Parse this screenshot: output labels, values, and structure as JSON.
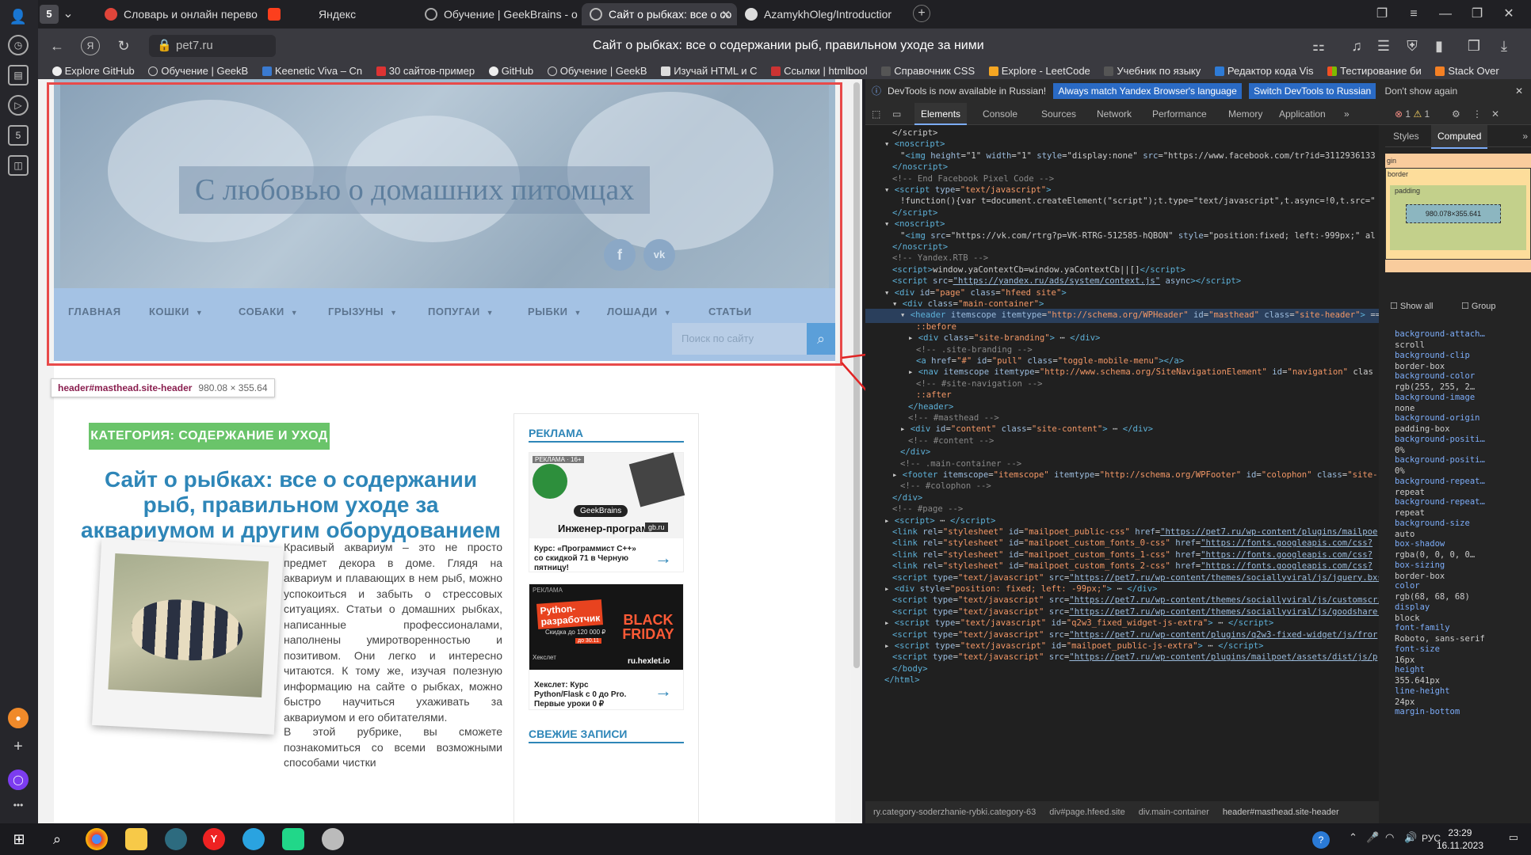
{
  "browser": {
    "tab_count": "5",
    "tabs": [
      {
        "label": "Словарь и онлайн перево"
      },
      {
        "label": "Яндекс"
      },
      {
        "label": "Обучение | GeekBrains - о"
      },
      {
        "label": "Сайт о рыбках: все о со"
      },
      {
        "label": "AzamykhOleg/Introductior"
      }
    ],
    "url": "pet7.ru",
    "page_title": "Сайт о рыбках: все о содержании рыб, правильном уходе за ними",
    "bookmarks": [
      "Explore GitHub",
      "Обучение | GeekB",
      "Keenetic Viva – Cn",
      "30 сайтов-пример",
      "GitHub",
      "Обучение | GeekB",
      "Изучай HTML и C",
      "Ссылки | htmlbool",
      "Справочник CSS",
      "Explore - LeetCode",
      "Учебник по языку",
      "Редактор кода Vis",
      "Тестирование би",
      "Stack Over"
    ]
  },
  "site": {
    "hero_title": "С любовью о домашних питомцах",
    "social": [
      "f",
      "vk"
    ],
    "menu": [
      "ГЛАВНАЯ",
      "КОШКИ",
      "СОБАКИ",
      "ГРЫЗУНЫ",
      "ПОПУГАИ",
      "РЫБКИ",
      "ЛОШАДИ",
      "СТАТЬИ"
    ],
    "search_placeholder": "Поиск по сайту",
    "category_label": "КАТЕГОРИЯ: СОДЕРЖАНИЕ И УХОД",
    "article_title": "Сайт о рыбках: все о содержании рыб, правильном уходе за аквариумом и другим оборудованием",
    "article_p1": "Красивый аквариум – это не просто предмет декора в доме. Глядя на аквариум и плавающих в нем рыб, можно успокоиться и забыть о стрессовых ситуациях. Статьи о домашних рыбках, написанные профессионалами, наполнены умиротворенностью и позитивом. Они легко и интересно читаются. К тому же, изучая полезную информацию на сайте о рыбках, можно быстро научиться ухаживать за аквариумом и его обитателями.",
    "article_p2": "В этой рубрике, вы сможете познакомиться со всеми возможными способами чистки",
    "sidebar": {
      "ads_heading": "РЕКЛАМА",
      "ad1_badge": "РЕКЛАМА · 16+",
      "ad1_brand": "GeekBrains",
      "ad1_headline": "Инженер-программист C++",
      "ad1_site": "gb.ru",
      "ad1_text": "Курс: «Программист C++» со скидкой 71 в Черную пятницу!",
      "ad2_badge": "РЕКЛАМА",
      "ad2_headline": "Python-разработчик",
      "ad2_discount": "Скидка до 120 000 ₽",
      "ad2_date": "до 30.11",
      "ad2_promo": "BLACK FRIDAY",
      "ad2_brand": "Хекслет",
      "ad2_site": "ru.hexlet.io",
      "ad2_text": "Хекслет: Курс Python/Flask с 0 до Pro. Первые уроки 0 ₽",
      "recent_heading": "СВЕЖИЕ ЗАПИСИ"
    },
    "inspect_tooltip": {
      "selector": "header#masthead.site-header",
      "size": "980.08 × 355.64"
    }
  },
  "devtools": {
    "banner_text": "DevTools is now available in Russian!",
    "banner_btn1": "Always match Yandex Browser's language",
    "banner_btn2": "Switch DevTools to Russian",
    "banner_btn3": "Don't show again",
    "tabs": [
      "Elements",
      "Console",
      "Sources",
      "Network",
      "Performance",
      "Memory",
      "Application"
    ],
    "errors": "1",
    "warnings": "1",
    "right_tabs": [
      "Styles",
      "Computed"
    ],
    "box_size": "980.078×355.641",
    "box_labels": {
      "margin": "gin",
      "border": "border",
      "padding": "padding",
      "dash": "–"
    },
    "show_all": "Show all",
    "group": "Group",
    "computed": [
      {
        "name": "background-attach…",
        "value": "scroll"
      },
      {
        "name": "background-clip",
        "value": "border-box"
      },
      {
        "name": "background-color",
        "value": "rgb(255, 255, 2…"
      },
      {
        "name": "background-image",
        "value": "none"
      },
      {
        "name": "background-origin",
        "value": "padding-box"
      },
      {
        "name": "background-positi…",
        "value": "0%"
      },
      {
        "name": "background-positi…",
        "value": "0%"
      },
      {
        "name": "background-repeat…",
        "value": "repeat"
      },
      {
        "name": "background-repeat…",
        "value": "repeat"
      },
      {
        "name": "background-size",
        "value": "auto"
      },
      {
        "name": "box-shadow",
        "value": "rgba(0, 0, 0, 0…"
      },
      {
        "name": "box-sizing",
        "value": "border-box"
      },
      {
        "name": "color",
        "value": "rgb(68, 68, 68)"
      },
      {
        "name": "display",
        "value": "block"
      },
      {
        "name": "font-family",
        "value": "Roboto, sans-serif"
      },
      {
        "name": "font-size",
        "value": "16px"
      },
      {
        "name": "height",
        "value": "355.641px"
      },
      {
        "name": "line-height",
        "value": "24px"
      },
      {
        "name": "margin-bottom",
        "value": ""
      }
    ],
    "breadcrumbs": [
      "ry.category-soderzhanie-rybki.category-63",
      "div#page.hfeed.site",
      "div.main-container",
      "header#masthead.site-header"
    ],
    "code_lines": [
      {
        "i": 2,
        "html": "&lt;/script&gt;"
      },
      {
        "i": 1,
        "html": "▾ <span class='tg'>&lt;noscript&gt;</span>"
      },
      {
        "i": 3,
        "html": "\"<span class='tg'>&lt;img</span> <span class='at'>height</span>=\"1\" <span class='at'>width</span>=\"1\" <span class='at'>style</span>=\"display:none\" <span class='at'>src</span>=\"https://www.facebook.com/tr?id=3112936133"
      },
      {
        "i": 2,
        "html": "<span class='tg'>&lt;/noscript&gt;</span>"
      },
      {
        "i": 2,
        "html": "<span class='cm'>&lt;!-- End Facebook Pixel Code --&gt;</span>"
      },
      {
        "i": 1,
        "html": "▾ <span class='tg'>&lt;script</span> <span class='at'>type</span>=<span class='av'>\"text/javascript\"</span><span class='tg'>&gt;</span>"
      },
      {
        "i": 3,
        "html": "!function(){var t=document.createElement(\"script\");t.type=\"text/javascript\",t.async=!0,t.src=\""
      },
      {
        "i": 2,
        "html": "<span class='tg'>&lt;/script&gt;</span>"
      },
      {
        "i": 1,
        "html": "▾ <span class='tg'>&lt;noscript&gt;</span>"
      },
      {
        "i": 3,
        "html": "\"<span class='tg'>&lt;img</span> <span class='at'>src</span>=\"https://vk.com/rtrg?p=VK-RTRG-512585-hQBON\" <span class='at'>style</span>=\"position:fixed; left:-999px;\" al"
      },
      {
        "i": 2,
        "html": "<span class='tg'>&lt;/noscript&gt;</span>"
      },
      {
        "i": 2,
        "html": "<span class='cm'>&lt;!-- Yandex.RTB --&gt;</span>"
      },
      {
        "i": 2,
        "html": "<span class='tg'>&lt;script&gt;</span>window.yaContextCb=window.yaContextCb||[]<span class='tg'>&lt;/script&gt;</span>"
      },
      {
        "i": 2,
        "html": "<span class='tg'>&lt;script</span> <span class='at'>src</span>=<span class='lk'>\"https://yandex.ru/ads/system/context.js\"</span> <span class='at'>async</span><span class='tg'>&gt;&lt;/script&gt;</span>"
      },
      {
        "i": 1,
        "html": "▾ <span class='tg'>&lt;div</span> <span class='at'>id</span>=<span class='av'>\"page\"</span> <span class='at'>class</span>=<span class='av'>\"hfeed site\"</span><span class='tg'>&gt;</span>"
      },
      {
        "i": 2,
        "html": "▾ <span class='tg'>&lt;div</span> <span class='at'>class</span>=<span class='av'>\"main-container\"</span><span class='tg'>&gt;</span>"
      },
      {
        "i": 3,
        "html": "▾ <span class='tg'>&lt;header</span> <span class='at'>itemscope</span> <span class='at'>itemtype</span>=<span class='av'>\"http://schema.org/WPHeader\"</span> <span class='at'>id</span>=<span class='av'>\"masthead\"</span> <span class='at'>class</span>=<span class='av'>\"site-header\"</span><span class='tg'>&gt;</span> == $0",
        "sel": true
      },
      {
        "i": 5,
        "html": "<span class='av'>::before</span>"
      },
      {
        "i": 4,
        "html": "▸ <span class='tg'>&lt;div</span> <span class='at'>class</span>=<span class='av'>\"site-branding\"</span><span class='tg'>&gt;</span> ⋯ <span class='tg'>&lt;/div&gt;</span>"
      },
      {
        "i": 5,
        "html": "<span class='cm'>&lt;!-- .site-branding --&gt;</span>"
      },
      {
        "i": 5,
        "html": "<span class='tg'>&lt;a</span> <span class='at'>href</span>=<span class='av'>\"#\"</span> <span class='at'>id</span>=<span class='av'>\"pull\"</span> <span class='at'>class</span>=<span class='av'>\"toggle-mobile-menu\"</span><span class='tg'>&gt;&lt;/a&gt;</span>"
      },
      {
        "i": 4,
        "html": "▸ <span class='tg'>&lt;nav</span> <span class='at'>itemscope</span> <span class='at'>itemtype</span>=<span class='av'>\"http://www.schema.org/SiteNavigationElement\"</span> <span class='at'>id</span>=<span class='av'>\"navigation\"</span> clas"
      },
      {
        "i": 5,
        "html": "<span class='cm'>&lt;!-- #site-navigation --&gt;</span>"
      },
      {
        "i": 5,
        "html": "<span class='av'>::after</span>"
      },
      {
        "i": 4,
        "html": "<span class='tg'>&lt;/header&gt;</span>"
      },
      {
        "i": 4,
        "html": "<span class='cm'>&lt;!-- #masthead --&gt;</span>"
      },
      {
        "i": 3,
        "html": "▸ <span class='tg'>&lt;div</span> <span class='at'>id</span>=<span class='av'>\"content\"</span> <span class='at'>class</span>=<span class='av'>\"site-content\"</span><span class='tg'>&gt;</span> ⋯ <span class='tg'>&lt;/div&gt;</span>"
      },
      {
        "i": 4,
        "html": "<span class='cm'>&lt;!-- #content --&gt;</span>"
      },
      {
        "i": 3,
        "html": "<span class='tg'>&lt;/div&gt;</span>"
      },
      {
        "i": 3,
        "html": "<span class='cm'>&lt;!-- .main-container --&gt;</span>"
      },
      {
        "i": 2,
        "html": "▸ <span class='tg'>&lt;footer</span> <span class='at'>itemscope</span>=<span class='av'>\"itemscope\"</span> <span class='at'>itemtype</span>=<span class='av'>\"http://schema.org/WPFooter\"</span> <span class='at'>id</span>=<span class='av'>\"colophon\"</span> <span class='at'>class</span>=<span class='av'>\"site-</span>"
      },
      {
        "i": 3,
        "html": "<span class='cm'>&lt;!-- #colophon --&gt;</span>"
      },
      {
        "i": 2,
        "html": "<span class='tg'>&lt;/div&gt;</span>"
      },
      {
        "i": 2,
        "html": "<span class='cm'>&lt;!-- #page --&gt;</span>"
      },
      {
        "i": 1,
        "html": "▸ <span class='tg'>&lt;script&gt;</span> ⋯ <span class='tg'>&lt;/script&gt;</span>"
      },
      {
        "i": 2,
        "html": "<span class='tg'>&lt;link</span> <span class='at'>rel</span>=<span class='av'>\"stylesheet\"</span> <span class='at'>id</span>=<span class='av'>\"mailpoet_public-css\"</span> <span class='at'>href</span>=<span class='lk'>\"https://pet7.ru/wp-content/plugins/mailpoe</span>"
      },
      {
        "i": 2,
        "html": "<span class='tg'>&lt;link</span> <span class='at'>rel</span>=<span class='av'>\"stylesheet\"</span> <span class='at'>id</span>=<span class='av'>\"mailpoet_custom_fonts_0-css\"</span> <span class='at'>href</span>=<span class='lk'>\"https://fonts.googleapis.com/css?</span>"
      },
      {
        "i": 2,
        "html": "<span class='tg'>&lt;link</span> <span class='at'>rel</span>=<span class='av'>\"stylesheet\"</span> <span class='at'>id</span>=<span class='av'>\"mailpoet_custom_fonts_1-css\"</span> <span class='at'>href</span>=<span class='lk'>\"https://fonts.googleapis.com/css?</span>"
      },
      {
        "i": 2,
        "html": "<span class='tg'>&lt;link</span> <span class='at'>rel</span>=<span class='av'>\"stylesheet\"</span> <span class='at'>id</span>=<span class='av'>\"mailpoet_custom_fonts_2-css\"</span> <span class='at'>href</span>=<span class='lk'>\"https://fonts.googleapis.com/css?</span>"
      },
      {
        "i": 2,
        "html": "<span class='tg'>&lt;script</span> <span class='at'>type</span>=<span class='av'>\"text/javascript\"</span> <span class='at'>src</span>=<span class='lk'>\"https://pet7.ru/wp-content/themes/sociallyviral/js/jquery.bxs</span>"
      },
      {
        "i": 1,
        "html": "▸ <span class='tg'>&lt;div</span> <span class='at'>style</span>=<span class='av'>\"position: fixed; left: -99px;\"</span><span class='tg'>&gt;</span> ⋯ <span class='tg'>&lt;/div&gt;</span>"
      },
      {
        "i": 2,
        "html": "<span class='tg'>&lt;script</span> <span class='at'>type</span>=<span class='av'>\"text/javascript\"</span> <span class='at'>src</span>=<span class='lk'>\"https://pet7.ru/wp-content/themes/sociallyviral/js/customscri</span>"
      },
      {
        "i": 2,
        "html": "<span class='tg'>&lt;script</span> <span class='at'>type</span>=<span class='av'>\"text/javascript\"</span> <span class='at'>src</span>=<span class='lk'>\"https://pet7.ru/wp-content/themes/sociallyviral/js/goodshare.</span>"
      },
      {
        "i": 1,
        "html": "▸ <span class='tg'>&lt;script</span> <span class='at'>type</span>=<span class='av'>\"text/javascript\"</span> <span class='at'>id</span>=<span class='av'>\"q2w3_fixed_widget-js-extra\"</span><span class='tg'>&gt;</span> ⋯ <span class='tg'>&lt;/script&gt;</span>"
      },
      {
        "i": 2,
        "html": "<span class='tg'>&lt;script</span> <span class='at'>type</span>=<span class='av'>\"text/javascript\"</span> <span class='at'>src</span>=<span class='lk'>\"https://pet7.ru/wp-content/plugins/q2w3-fixed-widget/js/fror</span>"
      },
      {
        "i": 1,
        "html": "▸ <span class='tg'>&lt;script</span> <span class='at'>type</span>=<span class='av'>\"text/javascript\"</span> <span class='at'>id</span>=<span class='av'>\"mailpoet_public-js-extra\"</span><span class='tg'>&gt;</span> ⋯ <span class='tg'>&lt;/script&gt;</span>"
      },
      {
        "i": 2,
        "html": "<span class='tg'>&lt;script</span> <span class='at'>type</span>=<span class='av'>\"text/javascript\"</span> <span class='at'>src</span>=<span class='lk'>\"https://pet7.ru/wp-content/plugins/mailpoet/assets/dist/js/p</span>"
      },
      {
        "i": 2,
        "html": "<span class='tg'>&lt;/body&gt;</span>"
      },
      {
        "i": 1,
        "html": "<span class='tg'>&lt;/html&gt;</span>"
      }
    ]
  },
  "taskbar": {
    "lang": "РУС",
    "time": "23:29",
    "date": "16.11.2023"
  },
  "colors": {
    "accent": "#2e86b8",
    "category": "#6ac46a",
    "highlight": "#e84a4a",
    "devtools_bg": "#202020"
  }
}
